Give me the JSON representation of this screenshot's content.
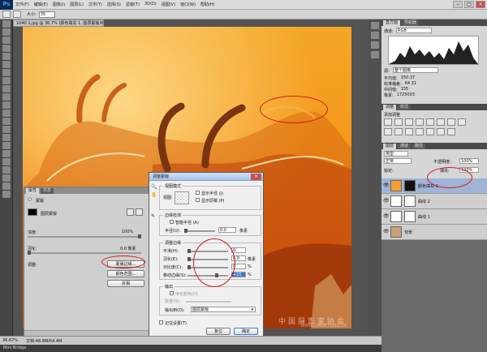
{
  "app": {
    "logo": "Ps"
  },
  "menu": [
    "文件(F)",
    "编辑(E)",
    "图像(I)",
    "图层(L)",
    "文字(Y)",
    "选择(S)",
    "滤镜(T)",
    "3D(D)",
    "视图(V)",
    "窗口(W)",
    "帮助(H)"
  ],
  "options": {
    "size_label": "大小:",
    "size_value": "35"
  },
  "document": {
    "tab_title": "1040 1.jpg @ 36.7% (颜色填充 1, 图层蒙版/8) *"
  },
  "status": {
    "zoom": "36.67%",
    "doc_info": "文档:48.8M/64.4M"
  },
  "minibridge": {
    "label": "Mini Bridge"
  },
  "properties_panel": {
    "tabs": [
      "属性",
      "信息"
    ],
    "section": "蒙版",
    "mask_label": "图层蒙版",
    "density_label": "浓度:",
    "density_value": "100%",
    "feather_label": "羽化:",
    "feather_value": "0.0 像素",
    "refine_label": "调整:",
    "btn_mask_edge": "蒙版边缘...",
    "btn_color_range": "颜色范围...",
    "btn_invert": "反相"
  },
  "refine_dialog": {
    "title": "调整蒙版",
    "view_mode_group": "视图模式",
    "view_label": "视图:",
    "show_radius": "显示半径 (J)",
    "show_original": "显示原稿 (P)",
    "edge_detect_group": "边缘检测",
    "smart_radius": "智能半径 (A)",
    "radius_label": "半径(U):",
    "radius_value": "0.0",
    "radius_unit": "像素",
    "adjust_edge_group": "调整边缘",
    "smooth_label": "平滑(H):",
    "smooth_value": "0",
    "feather_label": "羽化(E):",
    "feather_value": "0.0",
    "feather_unit": "像素",
    "contrast_label": "对比度(C):",
    "contrast_value": "0",
    "contrast_unit": "%",
    "shift_label": "移动边缘(S):",
    "shift_value": "+21",
    "shift_unit": "%",
    "output_group": "输出",
    "decontaminate": "净化颜色(D)",
    "amount_label": "数量(N):",
    "output_to_label": "输出到(O):",
    "output_to_value": "图层蒙版",
    "remember": "记住设置(T)",
    "cancel": "复位",
    "ok": "确定"
  },
  "histogram": {
    "tabs": [
      "直方图",
      "导航器"
    ],
    "channel_label": "通道:",
    "channel_value": "RGB",
    "source_label": "源:",
    "source_value": "整个图像",
    "stats": [
      {
        "k": "平均值:",
        "v": "150.37"
      },
      {
        "k": "标准偏差:",
        "v": "64.31"
      },
      {
        "k": "中间值:",
        "v": "155"
      },
      {
        "k": "像素:",
        "v": "1725003"
      }
    ]
  },
  "adjustments": {
    "tabs": [
      "调整",
      "样式"
    ],
    "title": "添加调整"
  },
  "layers": {
    "tabs": [
      "图层",
      "通道",
      "路径"
    ],
    "kind": "类型",
    "blend": "正常",
    "opacity_label": "不透明度:",
    "opacity_value": "100%",
    "lock_label": "锁定:",
    "fill_label": "填充:",
    "fill_value": "100%",
    "rows": [
      {
        "name": "颜色填充 1",
        "selected": true,
        "thumb": "#f4a030",
        "mask": "#111"
      },
      {
        "name": "曲线 2",
        "selected": false,
        "thumb": "#ffffff",
        "mask": "#ffffff"
      },
      {
        "name": "曲线 1",
        "selected": false,
        "thumb": "#ffffff",
        "mask": "#ffffff"
      },
      {
        "name": "背景",
        "selected": false,
        "thumb": "#c9a07a",
        "mask": null
      }
    ]
  },
  "watermark": {
    "cn": "中国摄影家协会",
    "en": "WWW.CPANET.ORG.CN"
  }
}
